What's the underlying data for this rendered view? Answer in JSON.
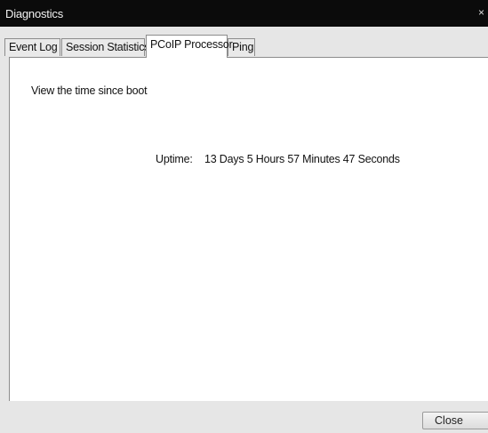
{
  "window": {
    "title": "Diagnostics",
    "close_glyph": "×"
  },
  "tabs": [
    {
      "label": "Event Log",
      "active": false
    },
    {
      "label": "Session Statistics",
      "active": false
    },
    {
      "label": "PCoIP Processor",
      "active": true
    },
    {
      "label": "Ping",
      "active": false
    }
  ],
  "panel": {
    "description": "View the time since boot",
    "uptime_label": "Uptime:",
    "uptime_value": "13 Days 5 Hours 57 Minutes 47 Seconds"
  },
  "footer": {
    "close_label": "Close"
  },
  "colors": {
    "titlebar": "#0b0b0b",
    "window_bg": "#e6e6e6",
    "panel_bg": "#ffffff",
    "border": "#8c8c8c"
  }
}
